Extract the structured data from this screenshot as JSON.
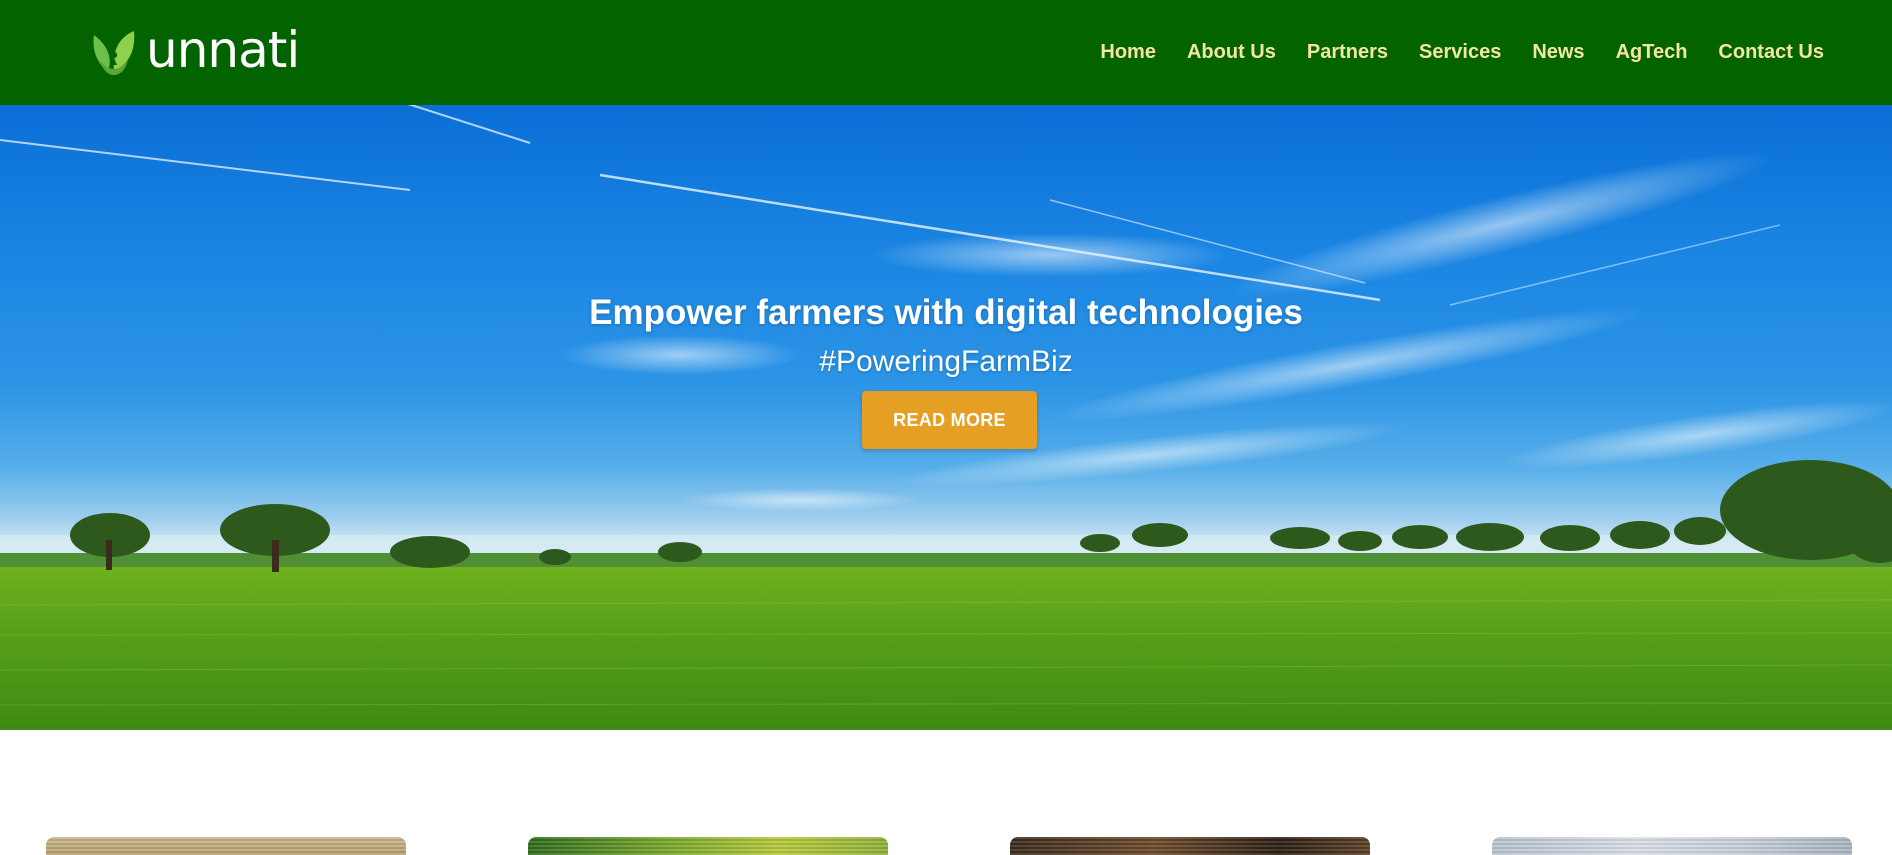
{
  "brand": {
    "name": "unnati",
    "logo_icon": "leaf-icon",
    "header_color": "#026300",
    "nav_text_color": "#f3e6a4"
  },
  "nav": {
    "items": [
      {
        "label": "Home"
      },
      {
        "label": "About Us"
      },
      {
        "label": "Partners"
      },
      {
        "label": "Services"
      },
      {
        "label": "News"
      },
      {
        "label": "AgTech"
      },
      {
        "label": "Contact Us"
      }
    ]
  },
  "hero": {
    "title": "Empower farmers with digital technologies",
    "subtitle": "#PoweringFarmBiz",
    "button_label": "READ MORE",
    "button_color": "#e5a024"
  },
  "cards": [
    {
      "image": "wheat-field-photo"
    },
    {
      "image": "green-crop-rows-photo"
    },
    {
      "image": "tree-bark-photo"
    },
    {
      "image": "cloudy-sky-photo"
    }
  ]
}
